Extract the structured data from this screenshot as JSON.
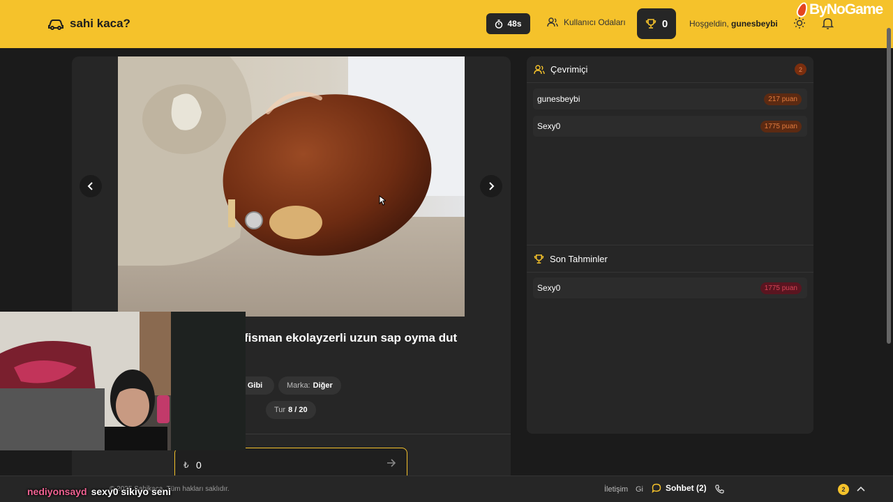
{
  "header": {
    "app_name": "sahi kaca?",
    "timer": "48s",
    "rooms_label": "Kullanıcı Odaları",
    "score": "0",
    "welcome_prefix": "Hoşgeldin,",
    "username": "gunesbeybi",
    "brand_overlay": "ByNoGame"
  },
  "game": {
    "title": "fisman ekolayzerli uzun sap oyma dut",
    "chips": {
      "condition": "ni Gibi",
      "brand_label": "Marka:",
      "brand_value": "Diğer",
      "round_label": "Tur",
      "round_value": "8 / 20"
    },
    "guess": {
      "currency": "₺",
      "value": "0"
    }
  },
  "online": {
    "title": "Çevrimiçi",
    "count": "2",
    "players": [
      {
        "name": "gunesbeybi",
        "points": "217 puan"
      },
      {
        "name": "Sexy0",
        "points": "1775 puan"
      }
    ]
  },
  "recent": {
    "title": "Son Tahminler",
    "entries": [
      {
        "name": "Sexy0",
        "points": "1775 puan"
      }
    ]
  },
  "footer": {
    "copyright": "© 2025 Sahikaca. Tüm hakları saklıdır.",
    "contact": "İletişim",
    "other": "Gi",
    "chat_label": "Sohbet (2)",
    "chat_badge": "2"
  },
  "stream_chat": {
    "user": "nediyonsayd",
    "message": "sexy0 sikiyo seni"
  },
  "colors": {
    "accent": "#f5c22b",
    "background": "#1b1b1b",
    "card": "#262626"
  }
}
